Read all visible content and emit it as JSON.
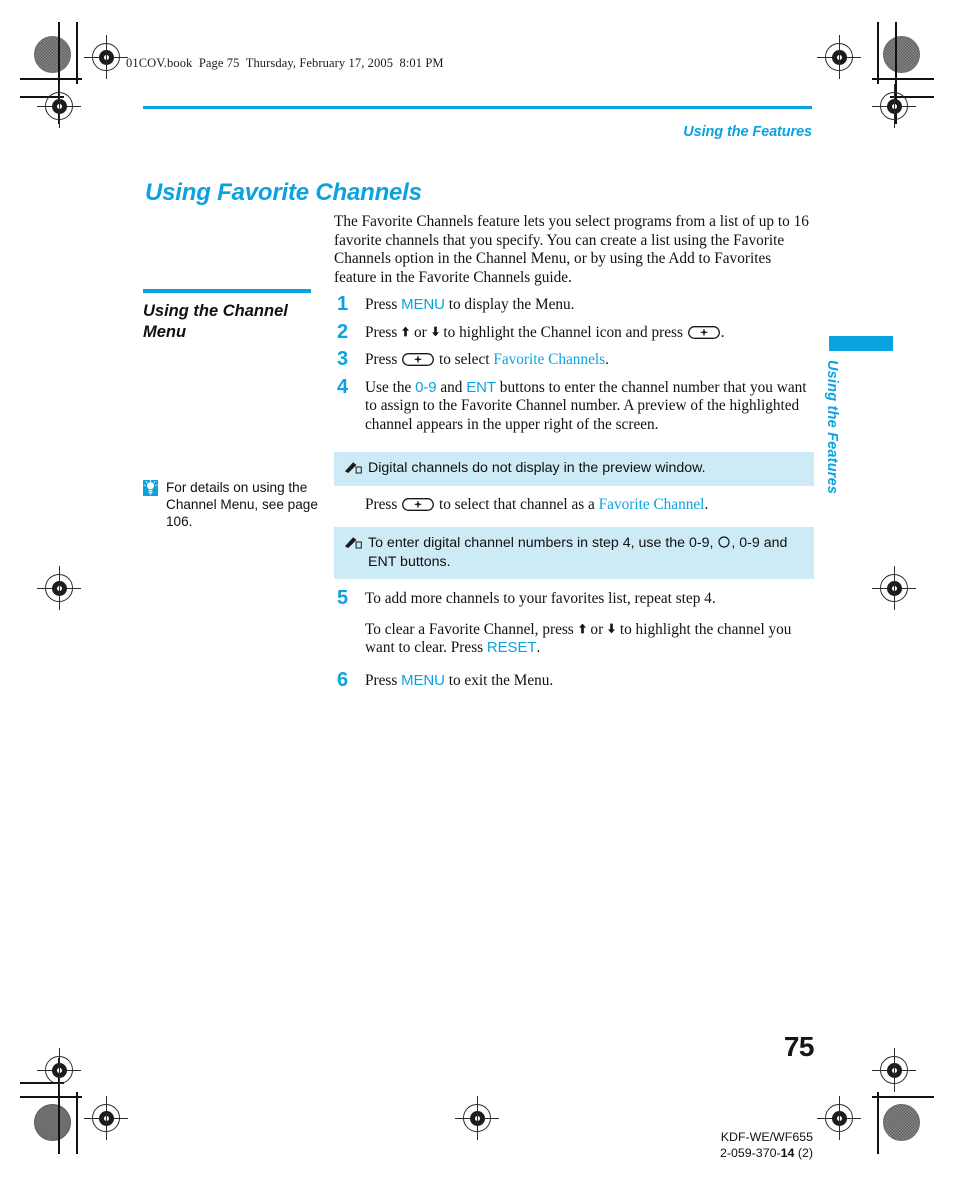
{
  "print_marks": {
    "file_stamp": "01COV.book  Page 75  Thursday, February 17, 2005  8:01 PM"
  },
  "header": {
    "running_head": "Using the Features",
    "chapter_title": "Using Favorite Channels"
  },
  "intro": "The Favorite Channels feature lets you select programs from a list of up to 16 favorite channels that you specify. You can create a list using the Favorite Channels option in the Channel Menu, or by using the Add to Favorites feature in the Favorite Channels guide.",
  "sidebar": {
    "section_heading": "Using the Channel Menu",
    "tip": {
      "icon": "lightbulb-icon",
      "text": "For details on using the Channel Menu, see page 106."
    }
  },
  "steps": [
    {
      "number": "1",
      "parts": [
        {
          "t": "text",
          "v": "Press "
        },
        {
          "t": "key",
          "v": "MENU"
        },
        {
          "t": "text",
          "v": " to display the Menu."
        }
      ]
    },
    {
      "number": "2",
      "parts": [
        {
          "t": "text",
          "v": "Press "
        },
        {
          "t": "glyph",
          "v": "♦"
        },
        {
          "t": "text",
          "v": " or "
        },
        {
          "t": "glyph",
          "v": "♦"
        },
        {
          "t": "text",
          "v": " to highlight the Channel icon and press "
        },
        {
          "t": "jog",
          "v": "jog-select-button"
        },
        {
          "t": "text",
          "v": "."
        }
      ]
    },
    {
      "number": "3",
      "parts": [
        {
          "t": "text",
          "v": "Press "
        },
        {
          "t": "jog",
          "v": "jog-select-button"
        },
        {
          "t": "text",
          "v": " to select "
        },
        {
          "t": "keyname",
          "v": "Favorite Channels"
        },
        {
          "t": "text",
          "v": "."
        }
      ]
    },
    {
      "number": "4",
      "parts": [
        {
          "t": "text",
          "v": "Use the "
        },
        {
          "t": "key",
          "v": "0-9"
        },
        {
          "t": "text",
          "v": " and "
        },
        {
          "t": "key",
          "v": "ENT"
        },
        {
          "t": "text",
          "v": " buttons to enter the channel number that you want to assign to the Favorite Channel number. A preview of the highlighted channel appears in the upper right of the screen."
        }
      ]
    },
    {
      "number": "5",
      "parts": [
        {
          "t": "text",
          "v": "To add more channels to your favorites list, repeat step 4."
        }
      ]
    },
    {
      "number": "6",
      "parts": [
        {
          "t": "text",
          "v": "Press "
        },
        {
          "t": "key",
          "v": "MENU"
        },
        {
          "t": "text",
          "v": " to exit the Menu."
        }
      ]
    }
  ],
  "sub_paragraphs": {
    "after_note1": [
      {
        "t": "text",
        "v": "Press "
      },
      {
        "t": "jog",
        "v": "jog-select-button"
      },
      {
        "t": "text",
        "v": " to select that channel as a "
      },
      {
        "t": "keyname",
        "v": "Favorite Channel"
      },
      {
        "t": "text",
        "v": "."
      }
    ],
    "step5_extra": [
      {
        "t": "text",
        "v": "To clear a Favorite Channel, press "
      },
      {
        "t": "glyph",
        "v": "♦"
      },
      {
        "t": "text",
        "v": " or "
      },
      {
        "t": "glyph",
        "v": "♦"
      },
      {
        "t": "text",
        "v": " to highlight the channel you want to clear. Press "
      },
      {
        "t": "key",
        "v": "RESET"
      },
      {
        "t": "text",
        "v": "."
      }
    ]
  },
  "notes": [
    {
      "icon": "pencil-note-icon",
      "parts": [
        {
          "t": "text",
          "v": "Digital channels do not display in the preview window."
        }
      ]
    },
    {
      "icon": "pencil-note-icon",
      "parts": [
        {
          "t": "text",
          "v": "To enter digital channel numbers in step 4, use the 0-9, "
        },
        {
          "t": "circ",
          "v": "circle-button"
        },
        {
          "t": "text",
          "v": ", 0-9 and ENT buttons."
        }
      ]
    }
  ],
  "thumb_tab": {
    "label": "Using the Features"
  },
  "footer": {
    "page_number": "75",
    "model": "KDF-WE/WF655",
    "doc_number_prefix": "2-059-370-",
    "doc_number_bold": "14",
    "doc_number_suffix": " (2)"
  },
  "colors": {
    "accent": "#0aa3e0",
    "note_bg": "#cdeaf7",
    "text": "#111111"
  }
}
